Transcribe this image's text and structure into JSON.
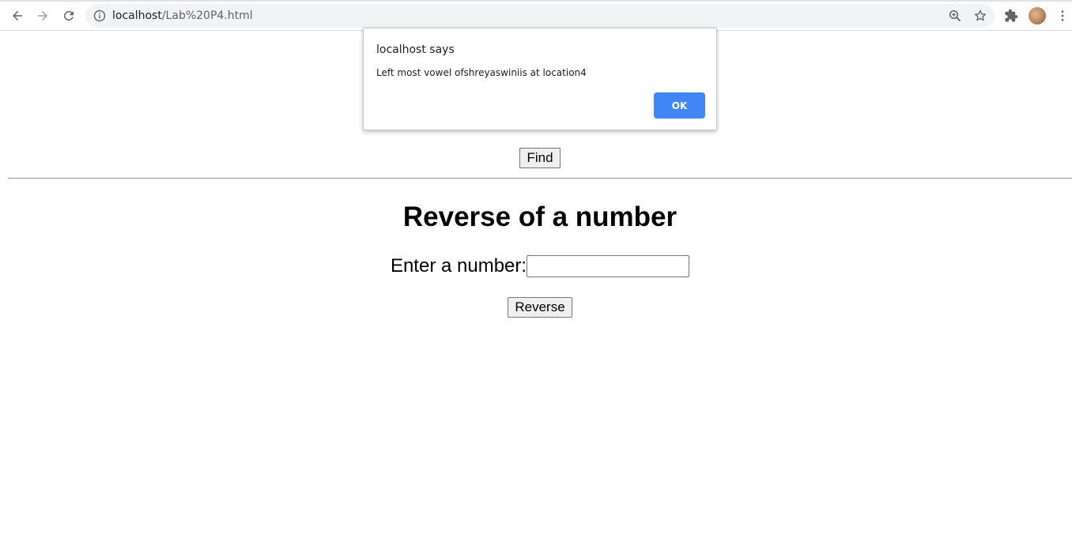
{
  "browser": {
    "url_host": "localhost",
    "url_path": "/Lab%20P4.html",
    "icons": [
      "back-arrow-icon",
      "forward-arrow-icon",
      "reload-icon",
      "info-icon",
      "zoom-icon",
      "star-icon",
      "extensions-icon",
      "profile-avatar",
      "menu-dots-icon"
    ]
  },
  "page": {
    "find_button_label": "Find",
    "heading": "Reverse of a number",
    "number_label": "Enter a number:",
    "number_value": "",
    "reverse_button_label": "Reverse"
  },
  "alert": {
    "title": "localhost says",
    "message": "Left most vowel ofshreyaswiniis at location4",
    "ok_label": "OK",
    "accent_color": "#4285f4"
  }
}
